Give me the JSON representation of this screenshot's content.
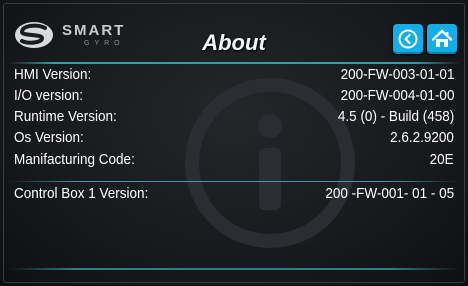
{
  "header": {
    "logo_word": "SMART",
    "logo_subword": "GYRO",
    "title": "About",
    "back_icon": "back-circle-icon",
    "home_icon": "home-icon"
  },
  "colors": {
    "accent": "#13aee8",
    "divider": "#3a9aa5",
    "background": "#17191c"
  },
  "info": {
    "rows": [
      {
        "label": "HMI Version:",
        "value": "200-FW-003-01-01"
      },
      {
        "label": "I/O version:",
        "value": "200-FW-004-01-00"
      },
      {
        "label": "Runtime Version:",
        "value": "4.5 (0) - Build (458)"
      },
      {
        "label": "Os Version:",
        "value": "2.6.2.9200"
      },
      {
        "label": "Manifacturing Code:",
        "value": "20E"
      },
      {
        "label": "Control Box 1 Version:",
        "value": "200 -FW-001- 01 - 05"
      }
    ]
  }
}
